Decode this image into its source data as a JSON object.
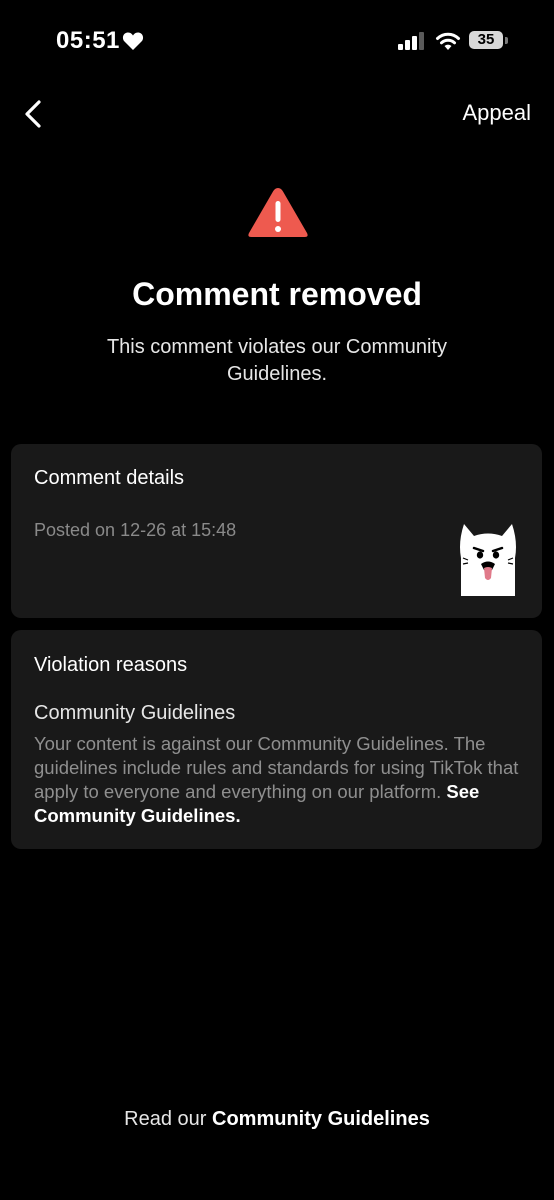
{
  "status_bar": {
    "time": "05:51",
    "battery": "35",
    "icons": [
      "heart-icon",
      "signal-icon",
      "wifi-icon",
      "battery-icon"
    ]
  },
  "nav": {
    "back_icon": "chevron-left-icon",
    "appeal_label": "Appeal"
  },
  "header": {
    "warning_icon": "warning-triangle-icon",
    "title": "Comment removed",
    "subtitle": "This comment violates our Community Guidelines."
  },
  "comment_details": {
    "heading": "Comment details",
    "posted": "Posted on 12-26 at 15:48",
    "sticker_icon": "cat-sticker-icon"
  },
  "violation": {
    "heading": "Violation reasons",
    "reason_title": "Community Guidelines",
    "reason_text": "Your content is against our Community Guidelines. The guidelines include rules and standards for using TikTok that apply to everyone and everything on our platform. ",
    "link": "See Community Guidelines."
  },
  "footer": {
    "prefix": "Read our ",
    "link": "Community Guidelines"
  },
  "colors": {
    "background": "#000000",
    "card": "#191919",
    "warning": "#ee5a4f",
    "muted_text": "#8f8f8f"
  }
}
